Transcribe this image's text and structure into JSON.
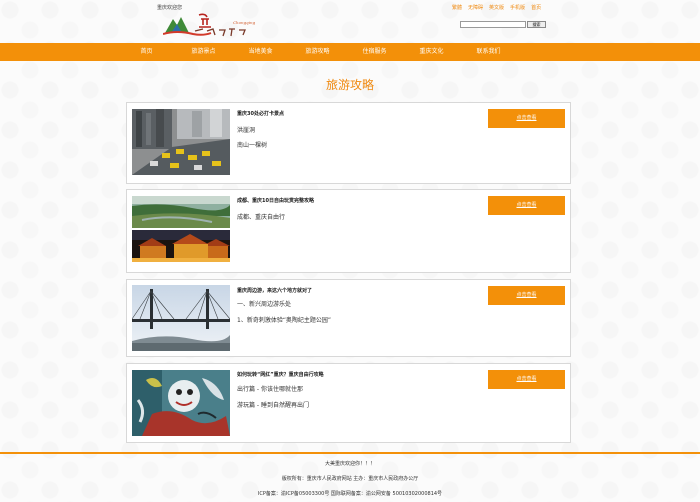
{
  "header": {
    "welcome": "重庆欢迎您",
    "top_links": [
      "繁體",
      "无障碍",
      "英文版",
      "手机版",
      "首页"
    ],
    "search": {
      "placeholder": "",
      "button": "搜索"
    }
  },
  "nav": {
    "items": [
      "首页",
      "旅游景点",
      "当地美食",
      "旅游攻略",
      "住宿服务",
      "重庆文化",
      "联系我们"
    ]
  },
  "page_title": "旅游攻略",
  "cards": [
    {
      "title": "重庆30处必打卡景点",
      "lines": [
        "洪崖洞",
        "南山一棵树"
      ],
      "button": "点击查看"
    },
    {
      "title": "成都、重庆10日自由玩赏完整攻略",
      "lines": [
        "成都、重庆自由行"
      ],
      "button": "点击查看"
    },
    {
      "title": "重庆周边游，来这六个地方就对了",
      "lines": [
        "一、新兴周边游乐处",
        "1、新奇刺激体验“奥陶纪主题公园”"
      ],
      "button": "点击查看"
    },
    {
      "title": "如何玩转“网红”重庆？重庆自由行攻略",
      "lines": [
        "出行篇 - 你该住哪就住那",
        "游玩篇 - 睡到自然醒再出门"
      ],
      "button": "点击查看"
    }
  ],
  "footer": {
    "line1": "大美重庆欢迎你！！！",
    "line2": "版权所有：重庆市人民政府网站 主办：重庆市人民政府办公厅",
    "line3": "ICP备案：渝ICP备05003300号 国际联网备案：渝公网安备 50010302000814号"
  },
  "colors": {
    "accent": "#f39009",
    "title": "#f08a10"
  }
}
